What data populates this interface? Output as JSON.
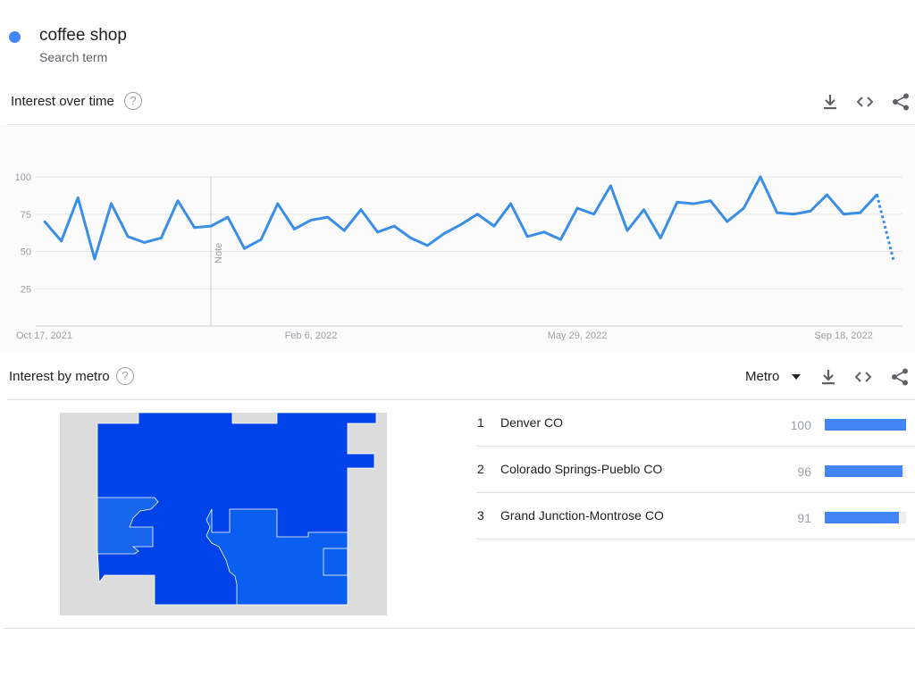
{
  "search_term": {
    "name": "coffee shop",
    "subtitle": "Search term",
    "color": "#4285f4"
  },
  "interest_over_time": {
    "title": "Interest over time",
    "help_icon": "?",
    "note_label": "Note",
    "tools": [
      "download-icon",
      "embed-icon",
      "share-icon"
    ]
  },
  "chart_data": {
    "type": "line",
    "title": "",
    "xlabel": "",
    "ylabel": "",
    "ylim": [
      0,
      100
    ],
    "y_ticks": [
      25,
      50,
      75,
      100
    ],
    "grid": true,
    "x_tick_labels": [
      "Oct 17, 2021",
      "Feb 6, 2022",
      "May 29, 2022",
      "Sep 18, 2022"
    ],
    "x_start": "Oct 17, 2021",
    "x_step_days": 7,
    "x_tick_dates": [
      "Oct 17, 2021",
      "Feb 6, 2022",
      "May 29, 2022",
      "Sep 18, 2022"
    ],
    "series": [
      {
        "color": "#3a8ee6",
        "values": [
          70,
          57,
          86,
          45,
          82,
          60,
          56,
          59,
          84,
          66,
          67,
          73,
          52,
          58,
          82,
          65,
          71,
          73,
          64,
          78,
          63,
          67,
          59,
          54,
          62,
          68,
          75,
          67,
          82,
          60,
          63,
          58,
          79,
          75,
          94,
          64,
          78,
          59,
          83,
          82,
          84,
          70,
          79,
          100,
          76,
          75,
          77,
          88,
          75,
          76,
          88
        ],
        "partial_values": [
          88,
          44
        ]
      }
    ]
  },
  "interest_by_metro": {
    "title": "Interest by metro",
    "help_icon": "?",
    "selector_label": "Metro",
    "tools": [
      "download-icon",
      "embed-icon",
      "share-icon"
    ],
    "map_colors": {
      "background": "#dcdcdc",
      "denver": "#0043e8",
      "colorado_springs": "#0a5ef0",
      "grand_junction": "#1866ec"
    },
    "metros": [
      {
        "rank": "1",
        "name": "Denver CO",
        "value": 100
      },
      {
        "rank": "2",
        "name": "Colorado Springs-Pueblo CO",
        "value": 96
      },
      {
        "rank": "3",
        "name": "Grand Junction-Montrose CO",
        "value": 91
      }
    ]
  }
}
